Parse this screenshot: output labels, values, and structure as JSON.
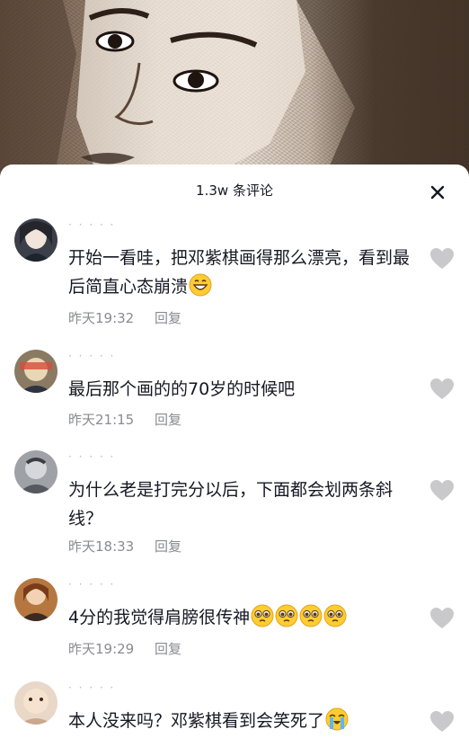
{
  "header": {
    "title": "1.3w 条评论",
    "close_icon": "close-icon"
  },
  "comments": [
    {
      "username": "· · · · ·",
      "text": "开始一看哇，把邓紫棋画得那么漂亮，看到最后简直心态崩溃",
      "emoji": [
        "grinning-face-emoji"
      ],
      "time": "昨天19:32",
      "reply_label": "回复"
    },
    {
      "username": "· · · · ·",
      "text": "最后那个画的的70岁的时候吧",
      "emoji": [],
      "time": "昨天21:15",
      "reply_label": "回复"
    },
    {
      "username": "· · · · ·",
      "text": "为什么老是打完分以后，下面都会划两条斜线？",
      "emoji": [],
      "time": "昨天18:33",
      "reply_label": "回复"
    },
    {
      "username": "· · · · ·",
      "text": "4分的我觉得肩膀很传神",
      "emoji": [
        "pleading-face-emoji",
        "pleading-face-emoji",
        "pleading-face-emoji",
        "pleading-face-emoji"
      ],
      "time": "昨天19:29",
      "reply_label": "回复"
    },
    {
      "username": "· · · · ·",
      "text": "本人没来吗？邓紫棋看到会笑死了",
      "emoji": [
        "loudly-crying-face-emoji"
      ],
      "time": "",
      "reply_label": ""
    }
  ],
  "icons": {
    "like": "heart-icon"
  },
  "colors": {
    "text": "#161823",
    "meta": "#8a8b91",
    "heart": "#c9c9cc"
  }
}
